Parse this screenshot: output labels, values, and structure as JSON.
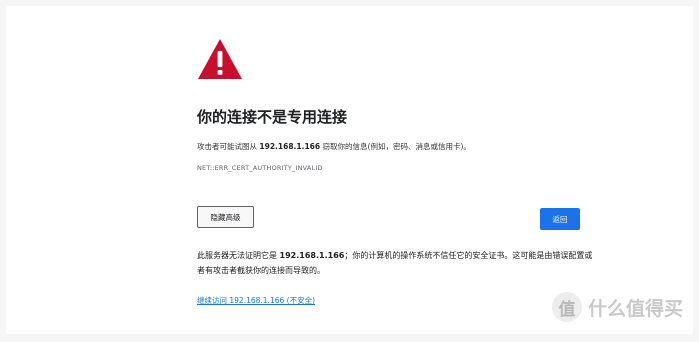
{
  "page": {
    "title": "你的连接不是专用连接",
    "description_prefix": "攻击者可能试图从",
    "host": "192.168.1.166",
    "description_suffix": "窃取你的信息(例如，密码、消息或信用卡)。",
    "error_code": "NET::ERR_CERT_AUTHORITY_INVALID",
    "advanced_button": "隐藏高级",
    "back_button": "返回",
    "details_prefix": "此服务器无法证明它是",
    "details_host": "192.168.1.166",
    "details_suffix": "；你的计算机的操作系统不信任它的安全证书。这可能是由错误配置或者有攻击者截获你的连接而导致的。",
    "proceed_link": "继续访问 192.168.1.166 (不安全)"
  },
  "colors": {
    "warning_icon": "#c8102e",
    "back_button_bg": "#1a73e8",
    "link": "#1a73e8"
  },
  "icons": {
    "warning": "warning-triangle-icon"
  },
  "watermark": {
    "logo_glyph": "值",
    "text": "什么值得买"
  }
}
